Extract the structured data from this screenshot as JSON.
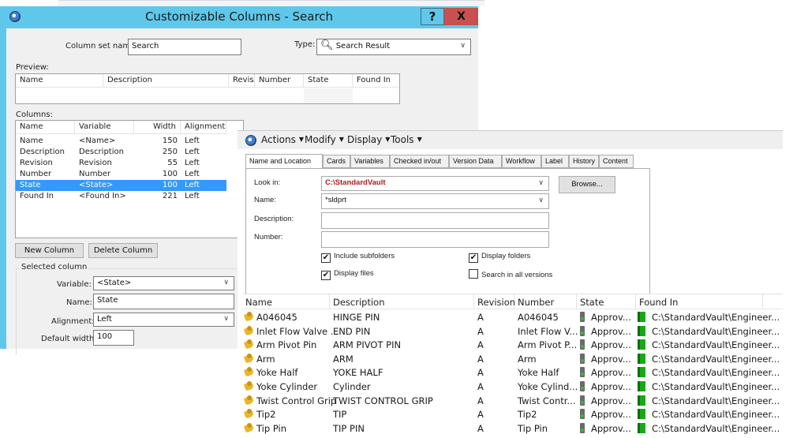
{
  "dialog": {
    "title": "Customizable Columns - Search",
    "help_label": "?",
    "close_label": "X",
    "column_set_label": "Column set name:",
    "column_set_value": "Search",
    "type_label": "Type:",
    "type_value": "Search Result",
    "preview_label": "Preview:",
    "preview_headers": [
      "Name",
      "Description",
      "Revis...",
      "Number",
      "State",
      "Found In"
    ],
    "columns_label": "Columns:",
    "columns_headers": [
      "Name",
      "Variable",
      "Width",
      "Alignment"
    ],
    "columns_rows": [
      {
        "name": "Name",
        "variable": "<Name>",
        "width": "150",
        "alignment": "Left"
      },
      {
        "name": "Description",
        "variable": "Description",
        "width": "250",
        "alignment": "Left"
      },
      {
        "name": "Revision",
        "variable": "Revision",
        "width": "55",
        "alignment": "Left"
      },
      {
        "name": "Number",
        "variable": "Number",
        "width": "100",
        "alignment": "Left"
      },
      {
        "name": "State",
        "variable": "<State>",
        "width": "100",
        "alignment": "Left"
      },
      {
        "name": "Found In",
        "variable": "<Found In>",
        "width": "221",
        "alignment": "Left"
      }
    ],
    "selected_row_index": 4,
    "new_column_label": "New Column",
    "delete_column_label": "Delete Column",
    "selected_column_label": "Selected column",
    "variable_label": "Variable:",
    "variable_value": "<State>",
    "name_label": "Name:",
    "name_value": "State",
    "alignment_label": "Alignment:",
    "alignment_value": "Left",
    "default_width_label": "Default width:",
    "default_width_value": "100"
  },
  "pdm": {
    "menu": [
      "Actions",
      "Modify",
      "Display",
      "Tools"
    ],
    "tabs": [
      "Name and Location",
      "Cards",
      "Variables",
      "Checked in/out",
      "Version Data",
      "Workflow",
      "Label",
      "History",
      "Content"
    ],
    "active_tab": "Name and Location",
    "look_in_label": "Look in:",
    "look_in_value": "C:\\StandardVault",
    "look_in_color": "#b01c1c",
    "browse_label": "Browse...",
    "name_label": "Name:",
    "name_value": "*sldprt",
    "description_label": "Description:",
    "description_value": "",
    "number_label": "Number:",
    "number_value": "",
    "checkboxes": [
      {
        "label": "Include subfolders",
        "checked": true
      },
      {
        "label": "Display folders",
        "checked": true
      },
      {
        "label": "Display files",
        "checked": true
      },
      {
        "label": "Search in all versions",
        "checked": false
      }
    ],
    "results_headers": [
      "Name",
      "Description",
      "Revision",
      "Number",
      "State",
      "Found In"
    ],
    "results": [
      {
        "name": "A046045",
        "description": "HINGE PIN",
        "revision": "A",
        "number": "A046045",
        "state": "Approv...",
        "found_in": "C:\\StandardVault\\Engineer..."
      },
      {
        "name": "Inlet Flow Valve ...",
        "description": "END PIN",
        "revision": "A",
        "number": "Inlet Flow V...",
        "state": "Approv...",
        "found_in": "C:\\StandardVault\\Engineer..."
      },
      {
        "name": "Arm Pivot Pin",
        "description": "ARM PIVOT PIN",
        "revision": "A",
        "number": "Arm Pivot P...",
        "state": "Approv...",
        "found_in": "C:\\StandardVault\\Engineer..."
      },
      {
        "name": "Arm",
        "description": "ARM",
        "revision": "A",
        "number": "Arm",
        "state": "Approv...",
        "found_in": "C:\\StandardVault\\Engineer..."
      },
      {
        "name": "Yoke Half",
        "description": "YOKE HALF",
        "revision": "A",
        "number": "Yoke Half",
        "state": "Approv...",
        "found_in": "C:\\StandardVault\\Engineer..."
      },
      {
        "name": "Yoke Cylinder",
        "description": "Cylinder",
        "revision": "A",
        "number": "Yoke Cylind...",
        "state": "Approv...",
        "found_in": "C:\\StandardVault\\Engineer..."
      },
      {
        "name": "Twist Control Grip",
        "description": "TWIST CONTROL GRIP",
        "revision": "A",
        "number": "Twist Contr...",
        "state": "Approv...",
        "found_in": "C:\\StandardVault\\Engineer..."
      },
      {
        "name": "Tip2",
        "description": "TIP",
        "revision": "A",
        "number": "Tip2",
        "state": "Approv...",
        "found_in": "C:\\StandardVault\\Engineer..."
      },
      {
        "name": "Tip Pin",
        "description": "TIP PIN",
        "revision": "A",
        "number": "Tip Pin",
        "state": "Approv...",
        "found_in": "C:\\StandardVault\\Engineer..."
      }
    ]
  }
}
